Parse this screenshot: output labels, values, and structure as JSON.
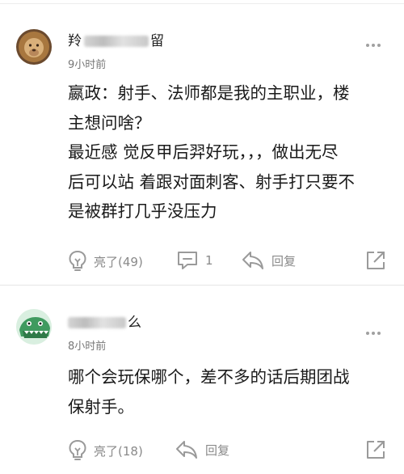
{
  "comments": [
    {
      "username_visible_start": "羚",
      "username_visible_end": "留",
      "time": "9小时前",
      "content_lines": [
        "嬴政：射手、法师都是我的主职业，楼",
        "主想问啥？",
        "最近感 觉反甲后羿好玩，，，做出无尽",
        "后可以站 着跟对面刺客、射手打只要不",
        "是被群打几乎没压力"
      ],
      "like_label": "亮了(49)",
      "comment_count": "1",
      "reply_label": "回复"
    },
    {
      "username_visible_end": "么",
      "time": "8小时前",
      "content_lines": [
        "哪个会玩保哪个，差不多的话后期团战",
        "保射手。"
      ],
      "like_label": "亮了(18)",
      "reply_label": "回复"
    }
  ],
  "icons": {
    "like": "lightbulb-like-icon",
    "comment": "comment-bubble-icon",
    "reply": "reply-arrow-icon",
    "share": "share-external-icon",
    "more": "more-dots-icon"
  },
  "colors": {
    "text": "#1a1a1a",
    "meta": "#777777",
    "icon": "#9a9a9a",
    "divider": "#e6e6e6"
  }
}
